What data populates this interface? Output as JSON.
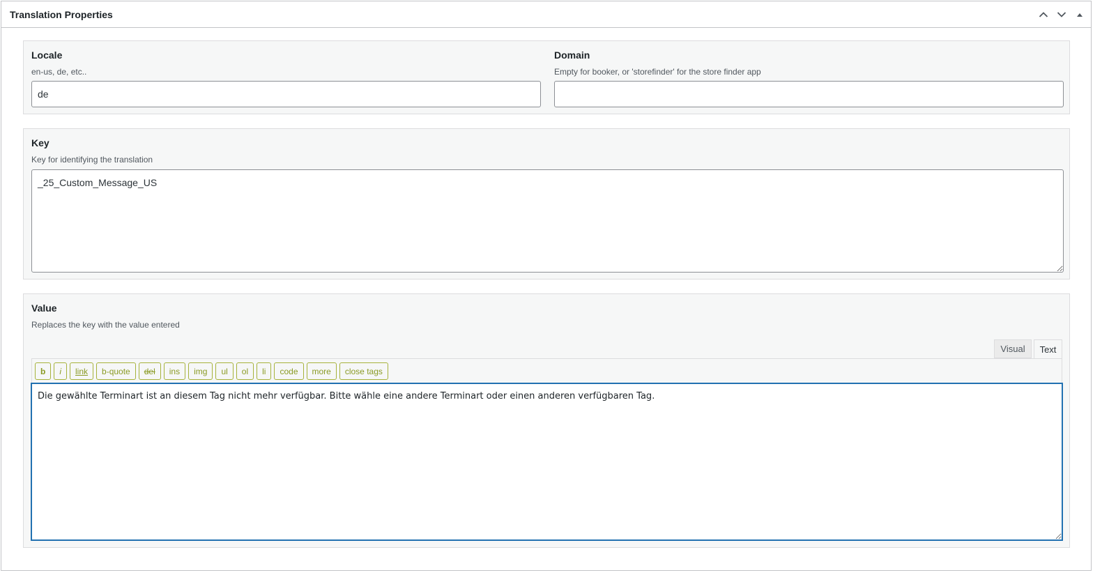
{
  "header": {
    "title": "Translation Properties"
  },
  "locale": {
    "label": "Locale",
    "description": "en-us, de, etc..",
    "value": "de"
  },
  "domain": {
    "label": "Domain",
    "description": "Empty for booker, or 'storefinder' for the store finder app",
    "value": ""
  },
  "key": {
    "label": "Key",
    "description": "Key for identifying the translation",
    "value": "_25_Custom_Message_US"
  },
  "value": {
    "label": "Value",
    "description": "Replaces the key with the value entered",
    "tabs": [
      "Visual",
      "Text"
    ],
    "active_tab": "Text",
    "quicktags": [
      "b",
      "i",
      "link",
      "b-quote",
      "del",
      "ins",
      "img",
      "ul",
      "ol",
      "li",
      "code",
      "more",
      "close tags"
    ],
    "content": "Die gewählte Terminart ist an diesem Tag nicht mehr verfügbar. Bitte wähle eine andere Terminart oder einen anderen verfügbaren Tag."
  },
  "icons": {
    "up": "chevron-up-icon",
    "down": "chevron-down-icon",
    "toggle": "toggle-arrow-icon"
  },
  "colors": {
    "quicktag_border": "#a6b23b",
    "quicktag_text": "#8a9a24",
    "focus_border": "#2271b1"
  }
}
